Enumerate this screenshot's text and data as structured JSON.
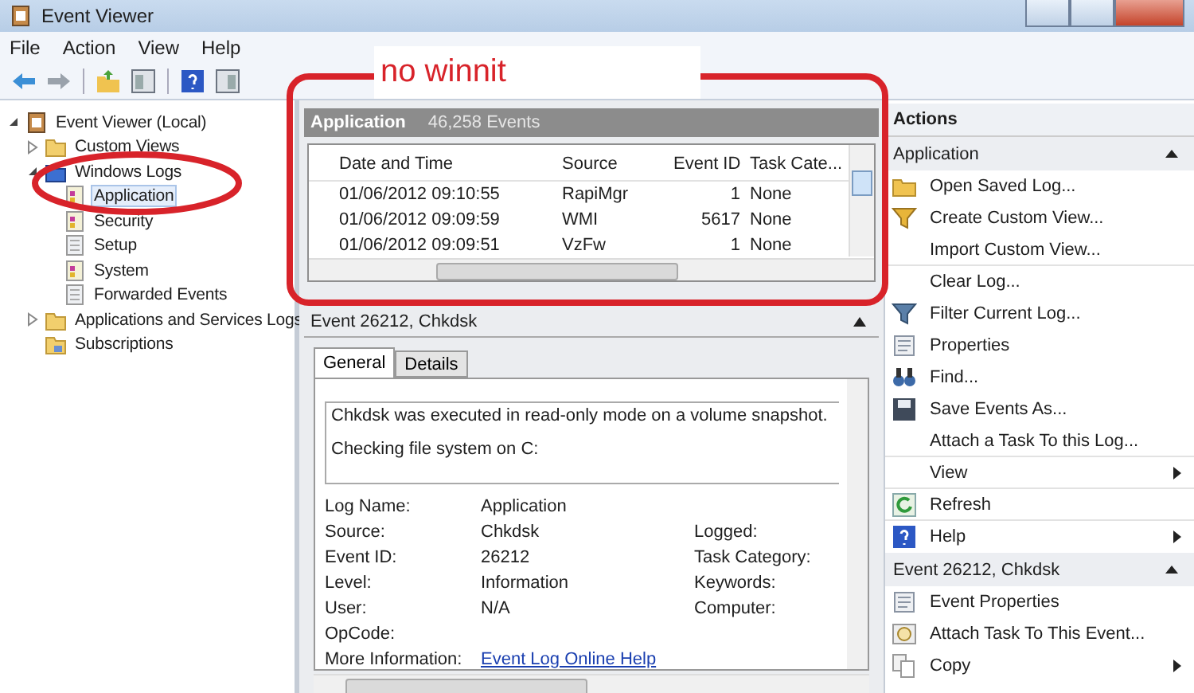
{
  "window": {
    "title": "Event Viewer"
  },
  "menu": [
    {
      "label": "File"
    },
    {
      "label": "Action"
    },
    {
      "label": "View"
    },
    {
      "label": "Help"
    }
  ],
  "tree": [
    {
      "label": "Event Viewer (Local)",
      "kind": "root",
      "selected": false,
      "expanded": true,
      "children": [
        {
          "label": "Custom Views",
          "kind": "folder",
          "selected": false,
          "expanded": false
        },
        {
          "label": "Windows Logs",
          "kind": "logs",
          "selected": false,
          "expanded": true,
          "children": [
            {
              "label": "Application",
              "kind": "log",
              "selected": true
            },
            {
              "label": "Security",
              "kind": "log",
              "selected": false
            },
            {
              "label": "Setup",
              "kind": "plain",
              "selected": false
            },
            {
              "label": "System",
              "kind": "log",
              "selected": false
            },
            {
              "label": "Forwarded Events",
              "kind": "plain",
              "selected": false
            }
          ]
        },
        {
          "label": "Applications and Services Logs",
          "kind": "folder",
          "selected": false,
          "expanded": false
        },
        {
          "label": "Subscriptions",
          "kind": "sub",
          "selected": false
        }
      ]
    }
  ],
  "log": {
    "title": "Application",
    "count": "46,258 Events",
    "columns": [
      "Date and Time",
      "Source",
      "Event ID",
      "Task Cate..."
    ],
    "rows": [
      [
        "01/06/2012 09:10:55",
        "RapiMgr",
        "1",
        "None"
      ],
      [
        "01/06/2012 09:09:59",
        "WMI",
        "5617",
        "None"
      ],
      [
        "01/06/2012 09:09:51",
        "VzFw",
        "1",
        "None"
      ]
    ]
  },
  "detail": {
    "title": "Event 26212, Chkdsk",
    "tabs": [
      {
        "label": "General",
        "selected": true
      },
      {
        "label": "Details",
        "selected": false
      }
    ],
    "description": [
      "Chkdsk was executed in read-only mode on a volume snapshot.",
      "Checking file system on C:"
    ],
    "fields": [
      {
        "label": "Log Name:",
        "value": "Application"
      },
      {
        "label": "Source:",
        "value": "Chkdsk",
        "label2": "Logged:"
      },
      {
        "label": "Event ID:",
        "value": "26212",
        "label2": "Task Category:"
      },
      {
        "label": "Level:",
        "value": "Information",
        "label2": "Keywords:"
      },
      {
        "label": "User:",
        "value": "N/A",
        "label2": "Computer:"
      },
      {
        "label": "OpCode:"
      },
      {
        "label": "More Information:",
        "link": "Event Log Online Help"
      }
    ]
  },
  "actions": {
    "title": "Actions",
    "sections": [
      {
        "title": "Application",
        "items": [
          {
            "label": "Open Saved Log...",
            "kind": "folder",
            "divider": false,
            "submenu": false
          },
          {
            "label": "Create Custom View...",
            "kind": "funnel",
            "divider": false,
            "submenu": false
          },
          {
            "label": "Import Custom View...",
            "kind": "plain",
            "divider": true,
            "submenu": false
          },
          {
            "label": "Clear Log...",
            "kind": "plain",
            "divider": false,
            "submenu": false
          },
          {
            "label": "Filter Current Log...",
            "kind": "filter",
            "divider": false,
            "submenu": false
          },
          {
            "label": "Properties",
            "kind": "sheet",
            "divider": false,
            "submenu": false
          },
          {
            "label": "Find...",
            "kind": "binoculars",
            "divider": false,
            "submenu": false
          },
          {
            "label": "Save Events As...",
            "kind": "disk",
            "divider": false,
            "submenu": false
          },
          {
            "label": "Attach a Task To this Log...",
            "kind": "plain",
            "divider": true,
            "submenu": false
          },
          {
            "label": "View",
            "kind": "plain",
            "submenu": true,
            "divider": true
          },
          {
            "label": "Refresh",
            "kind": "refresh",
            "divider": true,
            "submenu": false
          },
          {
            "label": "Help",
            "kind": "help",
            "submenu": true,
            "divider": false
          }
        ]
      },
      {
        "title": "Event 26212, Chkdsk",
        "items": [
          {
            "label": "Event Properties",
            "kind": "sheet",
            "divider": false,
            "submenu": false
          },
          {
            "label": "Attach Task To This Event...",
            "kind": "clock",
            "divider": false,
            "submenu": false
          },
          {
            "label": "Copy",
            "kind": "copy",
            "submenu": true,
            "divider": false
          }
        ]
      }
    ]
  },
  "annotation": {
    "text": "no winnit"
  }
}
